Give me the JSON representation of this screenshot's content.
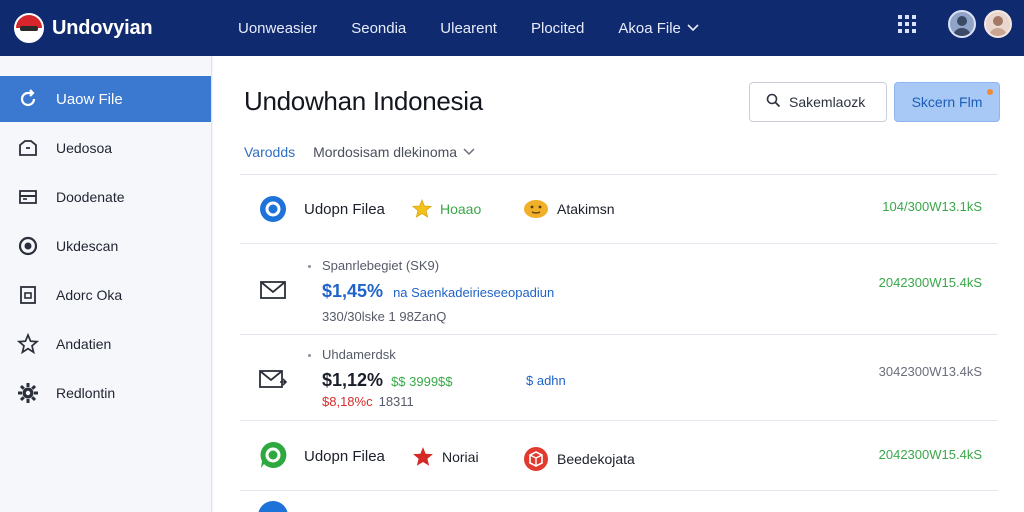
{
  "brand": {
    "name": "Undovyian"
  },
  "topnav": [
    {
      "label": "Uonweasier"
    },
    {
      "label": "Seondia"
    },
    {
      "label": "Ulearent"
    },
    {
      "label": "Plocited"
    },
    {
      "label": "Akoa File"
    }
  ],
  "sidebar": {
    "items": [
      {
        "label": "Uaow File",
        "icon": "refresh-icon",
        "active": true
      },
      {
        "label": "Uedosoa",
        "icon": "inbox-icon"
      },
      {
        "label": "Doodenate",
        "icon": "card-icon"
      },
      {
        "label": "Ukdescan",
        "icon": "circle-icon"
      },
      {
        "label": "Adorc Oka",
        "icon": "frame-icon"
      },
      {
        "label": "Andatien",
        "icon": "star-outline-icon"
      },
      {
        "label": "Redlontin",
        "icon": "gear-icon"
      }
    ]
  },
  "main": {
    "title": "Undowhan Indonesia",
    "search_label": "Sakemlaozk",
    "primary_label": "Skcern Flm",
    "tab_active": "Varodds",
    "tab_filter": "Mordosisam dlekinoma"
  },
  "rows": [
    {
      "name": "Udopn Filea",
      "tag1": "Hoaao",
      "tag2": "Atakimsn",
      "date": "104/300W13.1kS"
    },
    {
      "meta": "Spanrlebegiet (SK9)",
      "price": "$1,45%",
      "desc": "na Saenkadeirieseeopadiun",
      "sub": "330/30lske 1 98ZanQ",
      "date": "2042300W15.4kS"
    },
    {
      "meta": "Uhdamerdsk",
      "price": "$1,12%",
      "amount": "$$ 3999$$",
      "admin": "$ adhn",
      "price2": "$8,18%c",
      "sub2": "18311",
      "date": "3042300W13.4kS"
    },
    {
      "name": "Udopn Filea",
      "tag1": "Noriai",
      "tag2": "Beedekojata",
      "date": "2042300W15.4kS"
    }
  ],
  "colors": {
    "topbar": "#0f2a6e",
    "active": "#3b78cf",
    "green": "#3aa84a",
    "blue": "#1e63c9",
    "red": "#d52c2c"
  }
}
